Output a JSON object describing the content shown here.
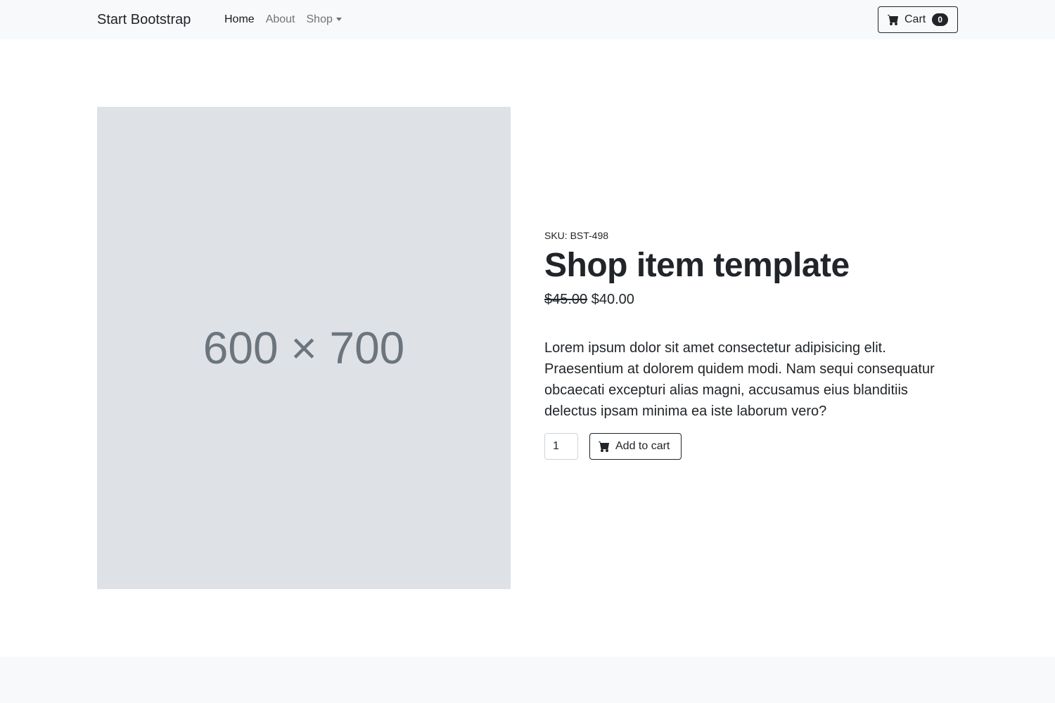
{
  "navbar": {
    "brand": "Start Bootstrap",
    "links": [
      {
        "label": "Home",
        "active": true
      },
      {
        "label": "About",
        "active": false
      },
      {
        "label": "Shop",
        "active": false,
        "dropdown": true
      }
    ],
    "cart": {
      "label": "Cart",
      "count": "0",
      "icon": "cart-icon"
    }
  },
  "product": {
    "image_placeholder": "600 × 700",
    "sku": "SKU: BST-498",
    "title": "Shop item template",
    "old_price": "$45.00",
    "price": "$40.00",
    "description": "Lorem ipsum dolor sit amet consectetur adipisicing elit. Praesentium at dolorem quidem modi. Nam sequi consequatur obcaecati excepturi alias magni, accusamus eius blanditiis delectus ipsam minima ea iste laborum vero?",
    "quantity": "1",
    "add_to_cart_label": "Add to cart"
  },
  "colors": {
    "navbar_bg": "#f8f9fa",
    "image_bg": "#dee2e6",
    "text": "#212529"
  }
}
